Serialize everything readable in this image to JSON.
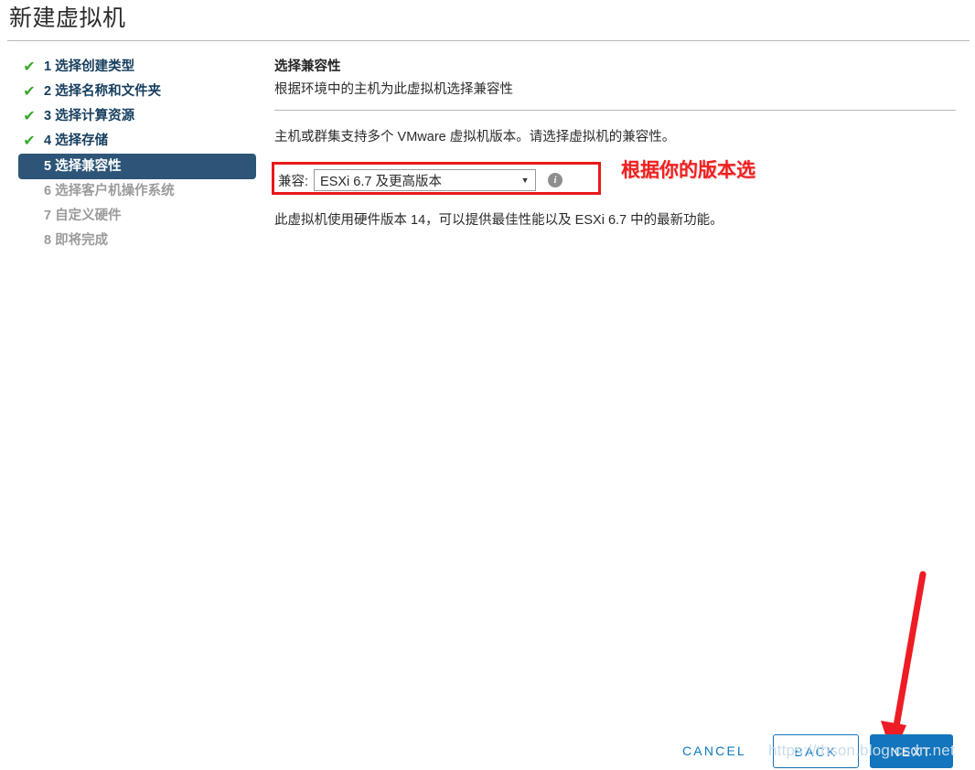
{
  "window": {
    "title": "新建虚拟机"
  },
  "steps": [
    {
      "num": "1",
      "label": "选择创建类型",
      "state": "done",
      "icon": "check-icon"
    },
    {
      "num": "2",
      "label": "选择名称和文件夹",
      "state": "done",
      "icon": "check-icon"
    },
    {
      "num": "3",
      "label": "选择计算资源",
      "state": "done",
      "icon": "check-icon"
    },
    {
      "num": "4",
      "label": "选择存储",
      "state": "done",
      "icon": "check-icon"
    },
    {
      "num": "5",
      "label": "选择兼容性",
      "state": "active",
      "icon": ""
    },
    {
      "num": "6",
      "label": "选择客户机操作系统",
      "state": "pending",
      "icon": ""
    },
    {
      "num": "7",
      "label": "自定义硬件",
      "state": "pending",
      "icon": ""
    },
    {
      "num": "8",
      "label": "即将完成",
      "state": "pending",
      "icon": ""
    }
  ],
  "panel": {
    "title": "选择兼容性",
    "subtitle": "根据环境中的主机为此虚拟机选择兼容性",
    "intro": "主机或群集支持多个 VMware 虚拟机版本。请选择虚拟机的兼容性。",
    "compat_label": "兼容:",
    "compat_value": "ESXi 6.7 及更高版本",
    "compat_arrow": "▼",
    "info_glyph": "i",
    "hardware_note": "此虚拟机使用硬件版本 14，可以提供最佳性能以及 ESXi 6.7 中的最新功能。"
  },
  "annotations": {
    "red_note": "根据你的版本选",
    "arrow_color": "#ee1c24",
    "box_color": "#e8181a"
  },
  "footer": {
    "cancel_label": "CANCEL",
    "back_label": "BACK",
    "next_label": "NEXT"
  },
  "watermark": {
    "text": "https://thson.blog.csdn.net"
  },
  "colors": {
    "accent_blue": "#1375bd",
    "active_step_bg": "#2c5578",
    "check_green": "#3aa82d",
    "annotation_red": "#ee2020"
  }
}
